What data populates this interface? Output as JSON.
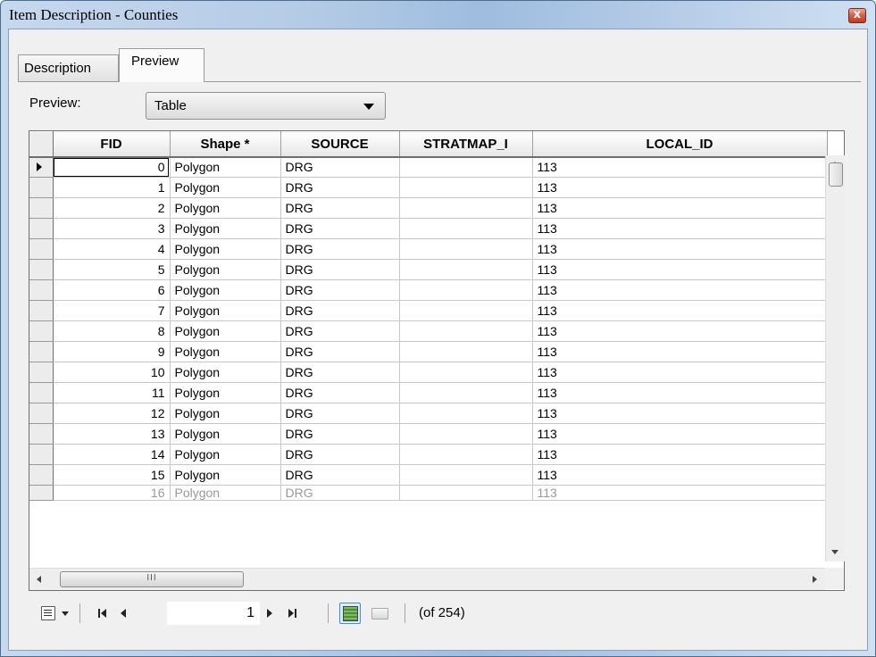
{
  "window": {
    "title": "Item Description - Counties",
    "close_label": "x"
  },
  "tabs": [
    {
      "label": "Description",
      "active": false
    },
    {
      "label": "Preview",
      "active": true
    }
  ],
  "preview": {
    "label": "Preview:",
    "selected": "Table"
  },
  "table": {
    "columns": [
      "FID",
      "Shape *",
      "SOURCE",
      "STRATMAP_I",
      "LOCAL_ID"
    ],
    "rows": [
      [
        "0",
        "Polygon",
        "DRG",
        "",
        "113"
      ],
      [
        "1",
        "Polygon",
        "DRG",
        "",
        "113"
      ],
      [
        "2",
        "Polygon",
        "DRG",
        "",
        "113"
      ],
      [
        "3",
        "Polygon",
        "DRG",
        "",
        "113"
      ],
      [
        "4",
        "Polygon",
        "DRG",
        "",
        "113"
      ],
      [
        "5",
        "Polygon",
        "DRG",
        "",
        "113"
      ],
      [
        "6",
        "Polygon",
        "DRG",
        "",
        "113"
      ],
      [
        "7",
        "Polygon",
        "DRG",
        "",
        "113"
      ],
      [
        "8",
        "Polygon",
        "DRG",
        "",
        "113"
      ],
      [
        "9",
        "Polygon",
        "DRG",
        "",
        "113"
      ],
      [
        "10",
        "Polygon",
        "DRG",
        "",
        "113"
      ],
      [
        "11",
        "Polygon",
        "DRG",
        "",
        "113"
      ],
      [
        "12",
        "Polygon",
        "DRG",
        "",
        "113"
      ],
      [
        "13",
        "Polygon",
        "DRG",
        "",
        "113"
      ],
      [
        "14",
        "Polygon",
        "DRG",
        "",
        "113"
      ],
      [
        "15",
        "Polygon",
        "DRG",
        "",
        "113"
      ],
      [
        "16",
        "Polygon",
        "DRG",
        "",
        "113"
      ]
    ],
    "current_row": 0
  },
  "hscroll": {
    "thumb_grip": "III"
  },
  "navigation": {
    "current_record": "1",
    "record_count": "(of 254)"
  },
  "icons": {
    "table_options": "table-options-icon",
    "first": "first-record-icon",
    "previous": "previous-record-icon",
    "next": "next-record-icon",
    "last": "last-record-icon",
    "show_all": "show-all-records-icon",
    "show_selected": "show-selected-records-icon"
  },
  "colors": {
    "title_bar": "#b4cbe6",
    "close_button": "#c23b22",
    "selected_toggle": "#dcecfc"
  }
}
